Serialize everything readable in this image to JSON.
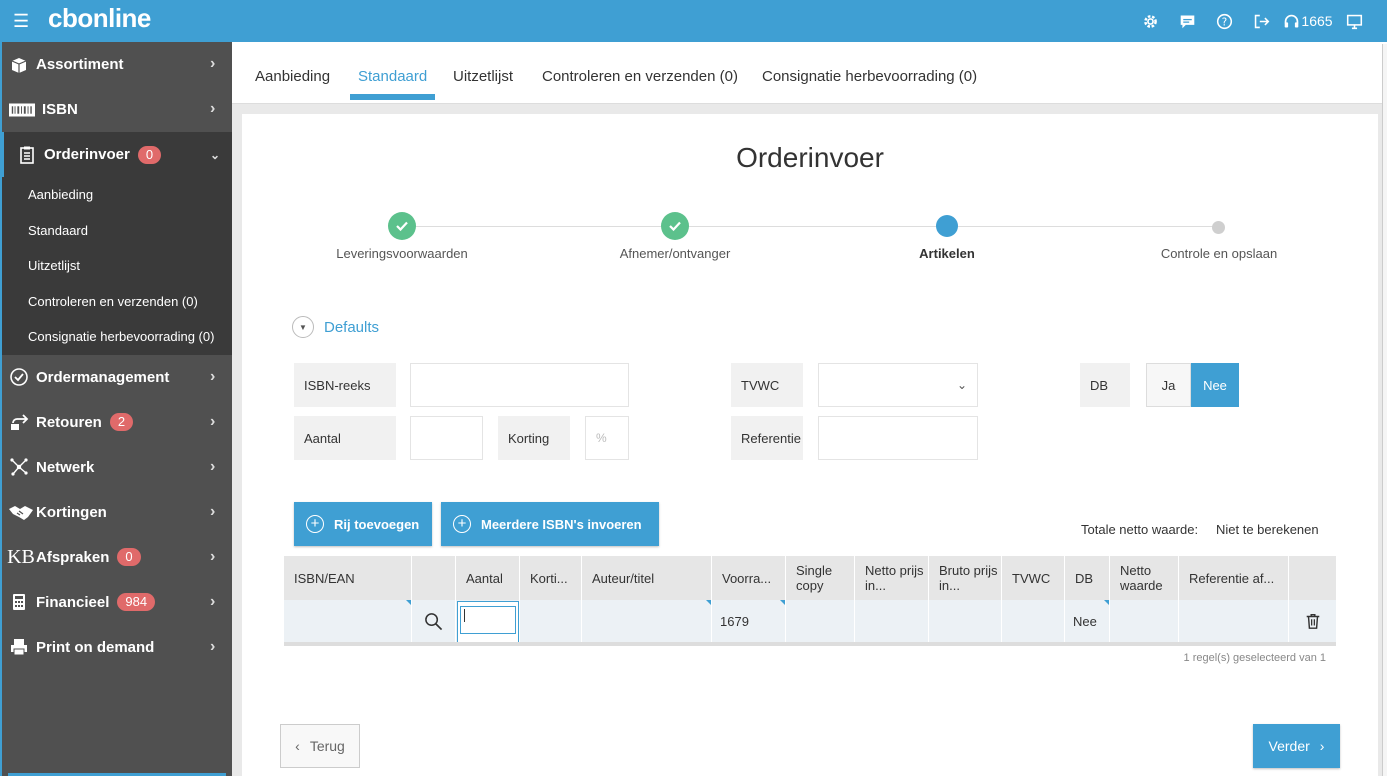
{
  "topbar": {
    "logo": "cbonline",
    "icons": [
      "gear-icon",
      "chat-icon",
      "help-icon",
      "logout-icon",
      "headset-icon",
      "monitor-icon"
    ],
    "headset_count": "1665",
    "color": "#3f9fd3"
  },
  "sidebar": {
    "items": [
      {
        "label": "Assortiment",
        "icon": "box-icon"
      },
      {
        "label": "ISBN",
        "icon": "barcode-icon"
      },
      {
        "label": "Orderinvoer",
        "icon": "clipboard-icon",
        "badge": "0"
      },
      {
        "label": "Ordermanagement",
        "icon": "check-circle-icon"
      },
      {
        "label": "Retouren",
        "icon": "return-icon",
        "badge": "2"
      },
      {
        "label": "Netwerk",
        "icon": "network-icon"
      },
      {
        "label": "Kortingen",
        "icon": "handshake-icon"
      },
      {
        "label": "Afspraken",
        "icon": "kb-icon",
        "badge": "0",
        "icon_text": "KB"
      },
      {
        "label": "Financieel",
        "icon": "calculator-icon",
        "badge": "984"
      },
      {
        "label": "Print on demand",
        "icon": "printer-icon"
      }
    ],
    "subitems": [
      "Aanbieding",
      "Standaard",
      "Uitzetlijst",
      "Controleren en verzenden (0)",
      "Consignatie herbevoorrading (0)"
    ]
  },
  "tabs": [
    {
      "label": "Aanbieding"
    },
    {
      "label": "Standaard",
      "active": true
    },
    {
      "label": "Uitzetlijst"
    },
    {
      "label": "Controleren en verzenden (0)"
    },
    {
      "label": "Consignatie herbevoorrading (0)"
    }
  ],
  "page": {
    "title": "Orderinvoer"
  },
  "steps": [
    {
      "label": "Leveringsvoorwaarden",
      "state": "done"
    },
    {
      "label": "Afnemer/ontvanger",
      "state": "done"
    },
    {
      "label": "Artikelen",
      "state": "current"
    },
    {
      "label": "Controle en opslaan",
      "state": "todo"
    }
  ],
  "defaults": {
    "label": "Defaults",
    "isbn_reeks_label": "ISBN-reeks",
    "isbn_reeks_value": "",
    "tvwc_label": "TVWC",
    "tvwc_value": "",
    "db_label": "DB",
    "db_yes": "Ja",
    "db_no": "Nee",
    "aantal_label": "Aantal",
    "aantal_value": "",
    "korting_label": "Korting",
    "korting_placeholder": "%",
    "referentie_label": "Referentie",
    "referentie_value": ""
  },
  "actions": {
    "add_row": "Rij toevoegen",
    "multi_isbn": "Meerdere ISBN's invoeren",
    "totals_label": "Totale netto waarde:",
    "totals_value": "Niet te berekenen"
  },
  "grid": {
    "columns": [
      "ISBN/EAN",
      "",
      "Aantal",
      "Korti...",
      "Auteur/titel",
      "Voorra...",
      "Single copy",
      "Netto prijs in...",
      "Bruto prijs in...",
      "TVWC",
      "DB",
      "Netto waarde",
      "Referentie af...",
      ""
    ],
    "row": {
      "isbn": "",
      "aantal": "",
      "korting": "",
      "auteur": "",
      "voorraad": "1679",
      "single_copy": "",
      "netto_prijs": "",
      "bruto_prijs": "",
      "tvwc": "",
      "db": "Nee",
      "netto_waarde": "",
      "referentie": ""
    },
    "selection_text": "1 regel(s) geselecteerd van   1"
  },
  "nav": {
    "back": "Terug",
    "next": "Verder"
  }
}
